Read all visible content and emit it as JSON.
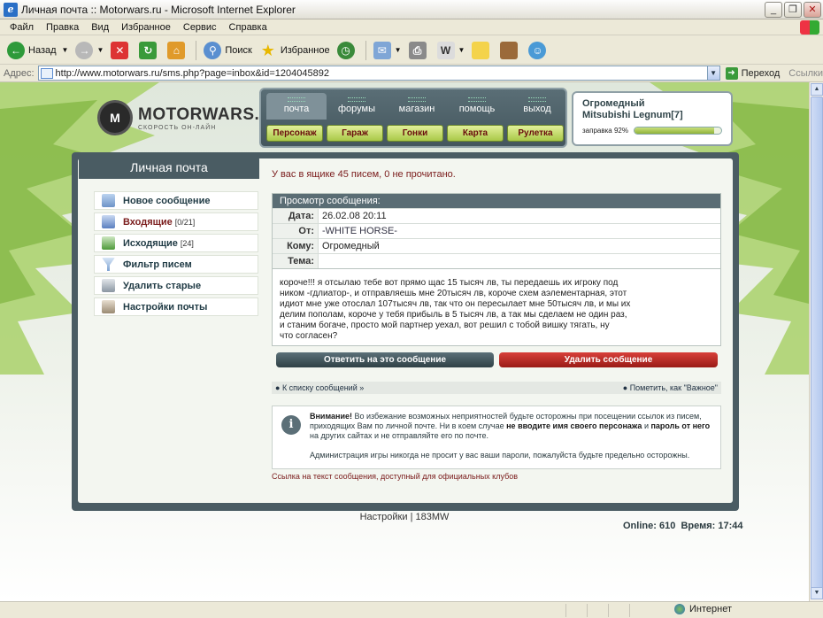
{
  "window": {
    "title": "Личная почта :: Motorwars.ru - Microsoft Internet Explorer"
  },
  "menu": [
    "Файл",
    "Правка",
    "Вид",
    "Избранное",
    "Сервис",
    "Справка"
  ],
  "toolbar": {
    "back": "Назад",
    "search": "Поиск",
    "favorites": "Избранное"
  },
  "address": {
    "label": "Адрес:",
    "url": "http://www.motorwars.ru/sms.php?page=inbox&id=1204045892",
    "go": "Переход",
    "links": "Ссылки"
  },
  "site": {
    "brand": "MOTORWARS.RU",
    "slogan": "СКОРОСТЬ ОН-ЛАЙН",
    "nav": [
      "почта",
      "форумы",
      "магазин",
      "помощь",
      "выход"
    ],
    "subnav": [
      "Персонаж",
      "Гараж",
      "Гонки",
      "Карта",
      "Рулетка"
    ],
    "car": {
      "owner": "Огромедный",
      "model": "Mitsubishi Legnum[7]",
      "fuel_label": "заправка 92%",
      "fuel_percent": 92
    }
  },
  "sidebar": {
    "title": "Личная почта",
    "items": [
      {
        "label": "Новое сообщение",
        "count": ""
      },
      {
        "label": "Входящие",
        "count": "[0/21]"
      },
      {
        "label": "Исходящие",
        "count": "[24]"
      },
      {
        "label": "Фильтр писем",
        "count": ""
      },
      {
        "label": "Удалить старые",
        "count": ""
      },
      {
        "label": "Настройки почты",
        "count": ""
      }
    ]
  },
  "mail": {
    "status": "У вас в ящике 45 писем, 0 не прочитано.",
    "view_title": "Просмотр сообщения:",
    "fields": {
      "date_label": "Дата:",
      "date": "26.02.08 20:11",
      "from_label": "От:",
      "from": "-WHITE HORSE-",
      "to_label": "Кому:",
      "to": "Огромедный",
      "subject_label": "Тема:",
      "subject": ""
    },
    "body": [
      "короче!!! я отсылаю тебе вот прямо щас 15 тысяч лв, ты передаешь их игроку под",
      "ником -гдлиатор-, и отправляешь мне 20тысяч лв, короче схем аэлементарная, этот",
      "идиот мне уже отослал 107тысяч лв, так что он пересылает мне 50тысяч лв, и мы их",
      "делим пополам, короче у тебя прибыль в 5 тысяч лв, а так мы сделаем не один раз,",
      "и станим богаче, просто мой партнер уехал, вот решил с тобой вишку тягать, ну",
      "что согласен?"
    ],
    "reply_button": "Ответить на это сообщение",
    "delete_button": "Удалить сообщение",
    "back_link": "К списку сообщений »",
    "mark_important": "Пометить, как \"Важное\""
  },
  "notice": {
    "attention": "Внимание!",
    "text1": " Во избежание возможных неприятностей будьте осторожны при посещении ссылок из писем, приходящих Вам по личной почте. Ни в коем случае ",
    "bold1": "не вводите имя своего персонажа",
    "text2": " и ",
    "bold2": "пароль от него",
    "text3": " на других сайтах и не отправляйте его по почте.",
    "admin": "Администрация игры никогда не просит у вас ваши пароли, пожалуйста будьте предельно осторожны."
  },
  "club_link": "Ссылка на текст сообщения, доступный для официальных клубов",
  "footer": {
    "settings": "Настройки",
    "sep": "|",
    "counter": "183MW"
  },
  "online": {
    "online_label": "Online:",
    "online_count": "610",
    "time_label": "Время:",
    "time": "17:44"
  },
  "statusbar": {
    "zone": "Интернет"
  },
  "colors": {
    "accent": "#4a5c63",
    "danger": "#b0221c",
    "lime": "#a9c848",
    "maroon": "#7a1b1b"
  }
}
